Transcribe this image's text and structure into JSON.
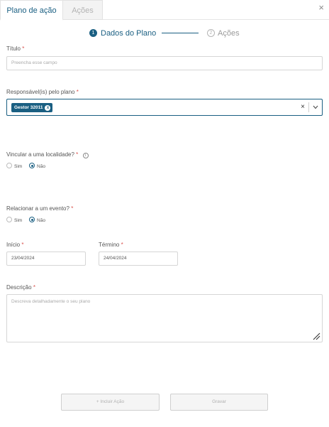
{
  "tabs": [
    {
      "label": "Plano de ação",
      "active": true
    },
    {
      "label": "Ações",
      "active": false
    }
  ],
  "close_label": "×",
  "stepper": {
    "steps": [
      {
        "number": "1",
        "label": "Dados do Plano",
        "active": true
      },
      {
        "number": "2",
        "label": "Ações",
        "active": false
      }
    ]
  },
  "form": {
    "title": {
      "label": "Título",
      "required_mark": "*",
      "placeholder": "Preencha esse campo"
    },
    "responsible": {
      "label": "Responsável(is) pelo plano",
      "required_mark": "*",
      "selected_tag": "Gestor 32011",
      "tag_remove": "x",
      "clear_icon": "×",
      "chevron_icon": "⌄"
    },
    "location": {
      "label": "Vincular a uma localidade?",
      "required_mark": "*",
      "info_icon": "i",
      "options": [
        {
          "label": "Sim",
          "checked": false
        },
        {
          "label": "Não",
          "checked": true
        }
      ]
    },
    "event": {
      "label": "Relacionar a um evento?",
      "required_mark": "*",
      "options": [
        {
          "label": "Sim",
          "checked": false
        },
        {
          "label": "Não",
          "checked": true
        }
      ]
    },
    "start": {
      "label": "Início",
      "required_mark": "*",
      "value": "23/04/2024"
    },
    "end": {
      "label": "Término",
      "required_mark": "*",
      "value": "24/04/2024"
    },
    "description": {
      "label": "Descrição",
      "required_mark": "*",
      "placeholder": "Descreva detalhadamente o seu plano"
    }
  },
  "buttons": {
    "add_action": "+ Incluir Ação",
    "save": "Gravar"
  },
  "colors": {
    "primary": "#1a5f82",
    "required": "#d9534f",
    "border": "#d6d6d6",
    "disabled_bg": "#f5f5f5"
  }
}
